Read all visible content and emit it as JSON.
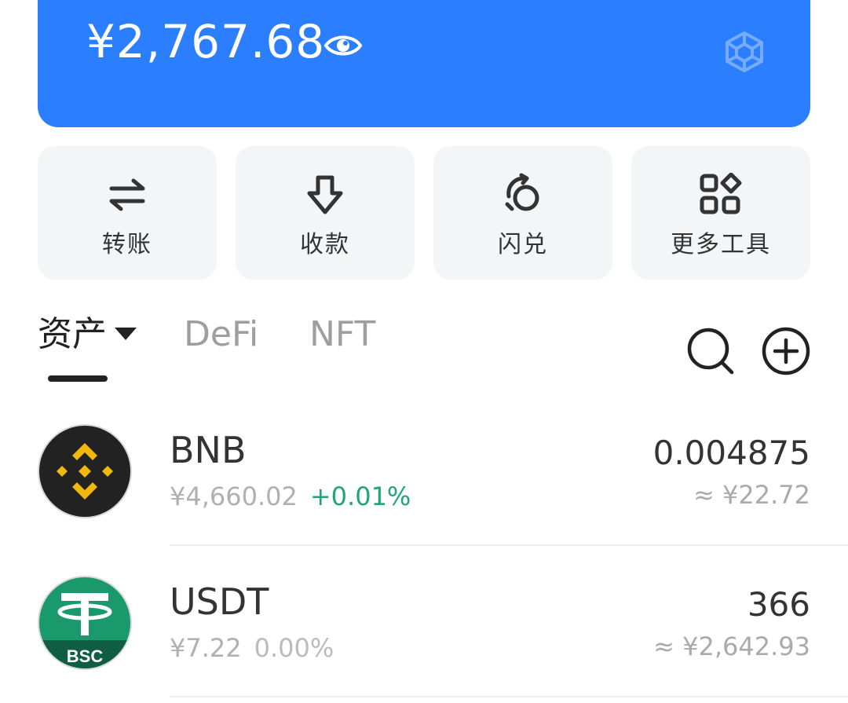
{
  "balance": {
    "amount": "¥2,767.68",
    "eye_icon": "eye-icon",
    "chain_logo": "bnb-chain-logo"
  },
  "actions": [
    {
      "label": "转账",
      "icon": "transfer-arrows-icon"
    },
    {
      "label": "收款",
      "icon": "receive-arrow-down-icon"
    },
    {
      "label": "闪兑",
      "icon": "swap-icon"
    },
    {
      "label": "更多工具",
      "icon": "grid-tools-icon"
    }
  ],
  "tabs": {
    "assets": "资产",
    "defi": "DeFi",
    "nft": "NFT",
    "active": "assets"
  },
  "assets": [
    {
      "symbol": "BNB",
      "price": "¥4,660.02",
      "change": "+0.01%",
      "change_color": "#1FA57A",
      "amount": "0.004875",
      "value": "≈ ¥22.72"
    },
    {
      "symbol": "USDT",
      "price": "¥7.22",
      "change": "0.00%",
      "change_color": "#BBBBBB",
      "amount": "366",
      "value": "≈ ¥2,642.93",
      "badge": "BSC"
    }
  ],
  "colors": {
    "brand_blue": "#2B7FFF",
    "tile_bg": "#F4F5F7",
    "bnb_yellow": "#F0B90B",
    "usdt_green": "#1A9A6C"
  }
}
